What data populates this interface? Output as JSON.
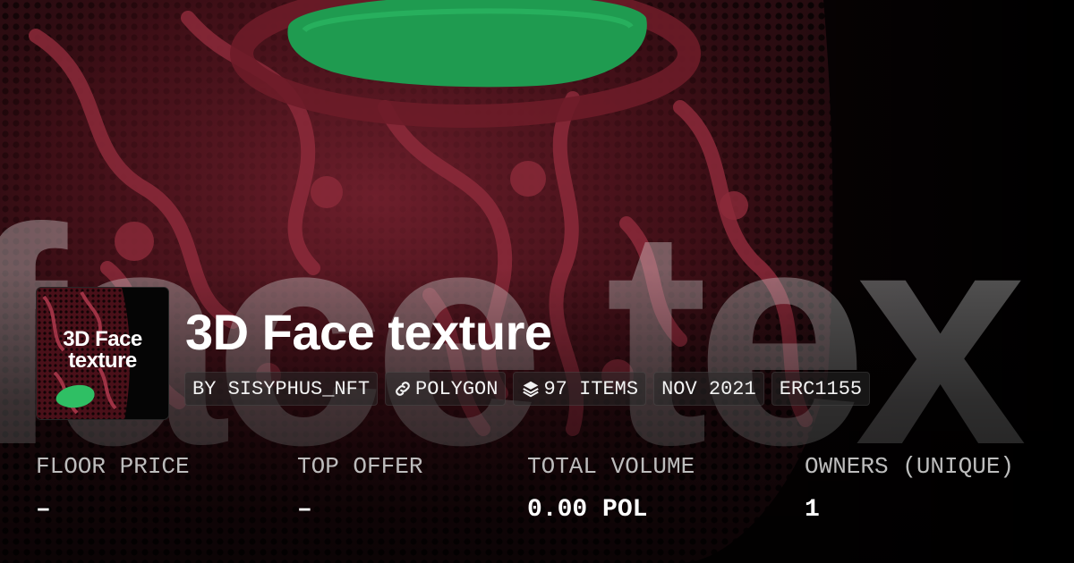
{
  "collection": {
    "name": "3D Face texture",
    "logo_text_line1": "3D Face",
    "logo_text_line2": "texture",
    "background_word": "face tex"
  },
  "chips": [
    {
      "label": "BY SISYPHUS_NFT",
      "icon": null
    },
    {
      "label": "POLYGON",
      "icon": "chain-link-icon"
    },
    {
      "label": "97 ITEMS",
      "icon": "layers-icon"
    },
    {
      "label": "NOV 2021",
      "icon": null
    },
    {
      "label": "ERC1155",
      "icon": null
    }
  ],
  "stats": [
    {
      "label": "FLOOR PRICE",
      "value": "–"
    },
    {
      "label": "TOP OFFER",
      "value": "–"
    },
    {
      "label": "TOTAL VOLUME",
      "value": "0.00 POL"
    },
    {
      "label": "OWNERS (UNIQUE)",
      "value": "1"
    }
  ],
  "colors": {
    "background": "#000000",
    "mask_red": "#5a1620",
    "mask_green": "#1f9b50",
    "label_gray": "#bdbdbd",
    "text": "#ffffff"
  }
}
